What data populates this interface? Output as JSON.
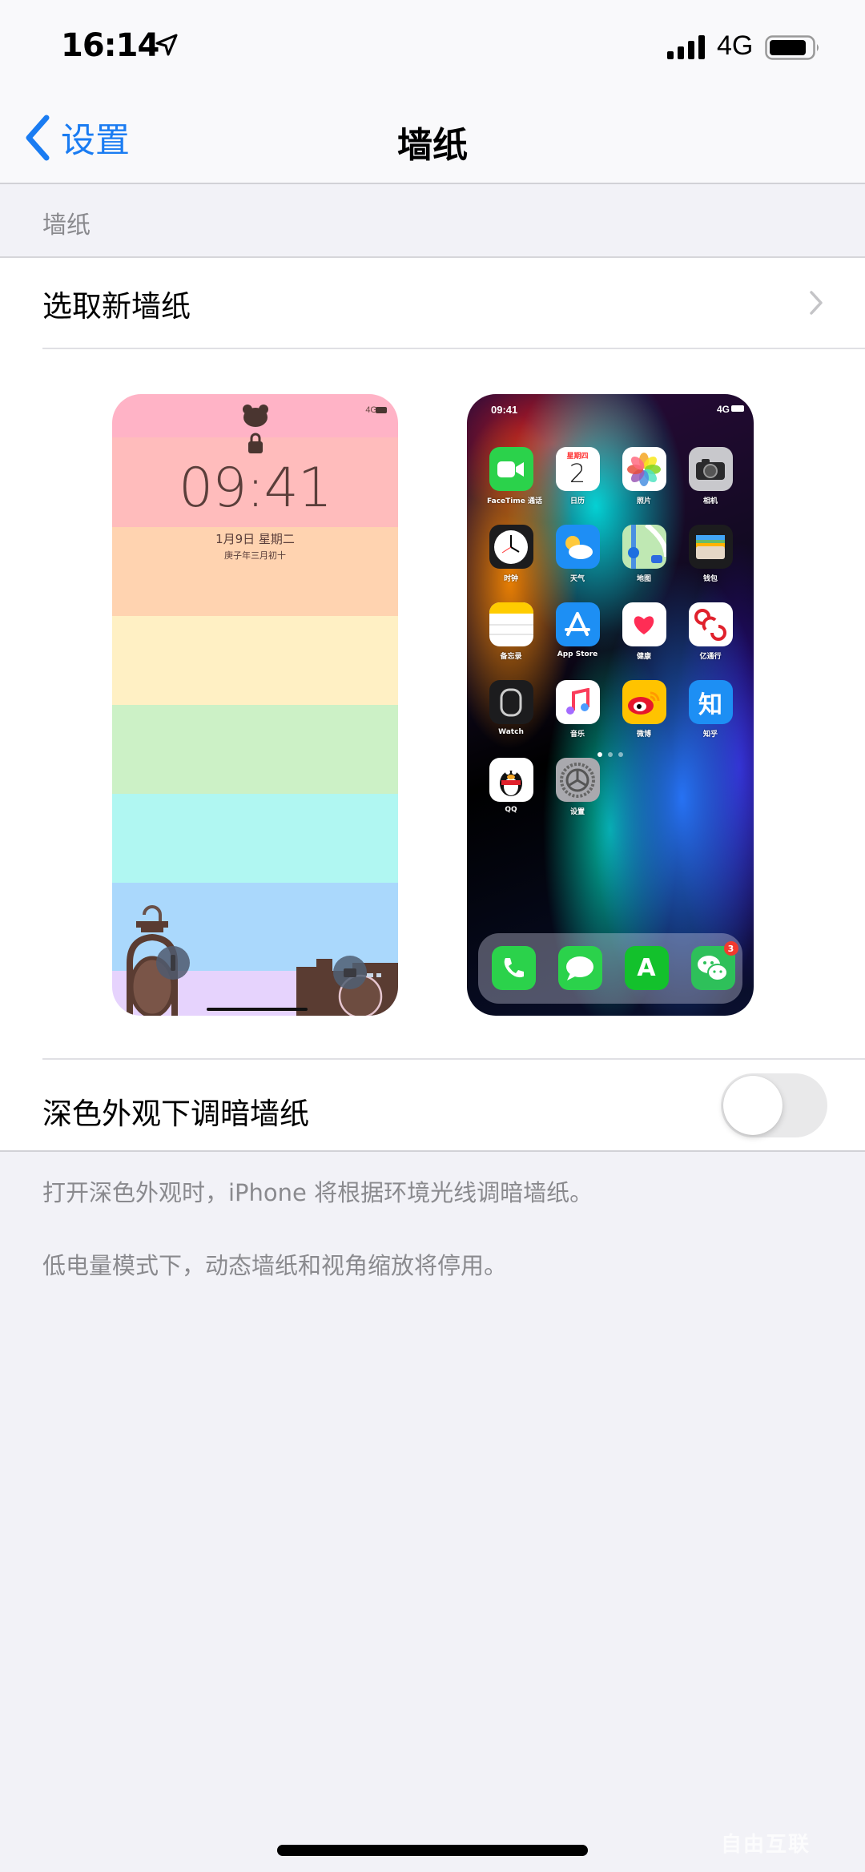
{
  "status_bar": {
    "time": "16:14",
    "network": "4G",
    "location_icon": "location-arrow-icon",
    "signal_icon": "cellular-signal-icon",
    "battery_icon": "battery-icon"
  },
  "nav": {
    "back_label": "设置",
    "title": "墙纸",
    "back_icon": "chevron-left-icon"
  },
  "section": {
    "header": "墙纸"
  },
  "choose_row": {
    "label": "选取新墙纸",
    "chevron_icon": "chevron-right-icon"
  },
  "lock_preview": {
    "network": "4G",
    "time": "09:41",
    "date": "1月9日 星期二",
    "lunar": "庚子年三月初十",
    "stripe_colors": [
      "#ffb3c6",
      "#ffbcbc",
      "#ffd3b0",
      "#fff0c4",
      "#ccf1c6",
      "#b0f7f2",
      "#aad8fc",
      "#e6d3fd"
    ]
  },
  "home_preview": {
    "time": "09:41",
    "network": "4G",
    "apps": [
      {
        "label": "FaceTime 通话",
        "icon": "facetime-icon",
        "bg": "#2bd24b"
      },
      {
        "label": "日历",
        "icon": "calendar-icon",
        "bg": "#ffffff",
        "weekday": "星期四",
        "day": "2"
      },
      {
        "label": "照片",
        "icon": "photos-icon",
        "bg": "#ffffff"
      },
      {
        "label": "相机",
        "icon": "camera-icon",
        "bg": "#c8c8cc"
      },
      {
        "label": "时钟",
        "icon": "clock-icon",
        "bg": "#1c1c1e"
      },
      {
        "label": "天气",
        "icon": "weather-icon",
        "bg": "#1e8ef5"
      },
      {
        "label": "地图",
        "icon": "maps-icon",
        "bg": "#bfe8b3"
      },
      {
        "label": "钱包",
        "icon": "wallet-icon",
        "bg": "#1c1c1e"
      },
      {
        "label": "备忘录",
        "icon": "notes-icon",
        "bg": "#ffffff"
      },
      {
        "label": "App Store",
        "icon": "app-store-icon",
        "bg": "#1d8ff4"
      },
      {
        "label": "健康",
        "icon": "health-icon",
        "bg": "#ffffff"
      },
      {
        "label": "亿通行",
        "icon": "yitongxing-icon",
        "bg": "#ffffff"
      },
      {
        "label": "Watch",
        "icon": "watch-icon",
        "bg": "#1c1c1e"
      },
      {
        "label": "音乐",
        "icon": "music-icon",
        "bg": "#ffffff"
      },
      {
        "label": "微博",
        "icon": "weibo-icon",
        "bg": "#ffc300"
      },
      {
        "label": "知乎",
        "icon": "zhihu-icon",
        "bg": "#1d8ff4",
        "glyph": "知"
      },
      {
        "label": "QQ",
        "icon": "qq-icon",
        "bg": "#ffffff"
      },
      {
        "label": "设置",
        "icon": "settings-icon",
        "bg": "#a9a9ae"
      }
    ],
    "page_count": 3,
    "current_page": 1,
    "dock": [
      {
        "icon": "phone-icon",
        "bg": "#2bd24b"
      },
      {
        "icon": "messages-icon",
        "bg": "#2bd24b"
      },
      {
        "icon": "a-app-icon",
        "bg": "#13c12c",
        "glyph": "A"
      },
      {
        "icon": "wechat-icon",
        "bg": "#2ec05a",
        "badge": "3"
      }
    ]
  },
  "dark_row": {
    "label": "深色外观下调暗墙纸",
    "toggle_on": false
  },
  "footer": {
    "line1": "打开深色外观时，iPhone 将根据环境光线调暗墙纸。",
    "line2": "低电量模式下，动态墙纸和视角缩放将停用。"
  },
  "watermark": "自由互联",
  "colors": {
    "accent": "#1a7cf2",
    "background": "#f2f2f7",
    "secondary_text": "#8a8a8e",
    "toggle_off": "#e9e9ea"
  }
}
